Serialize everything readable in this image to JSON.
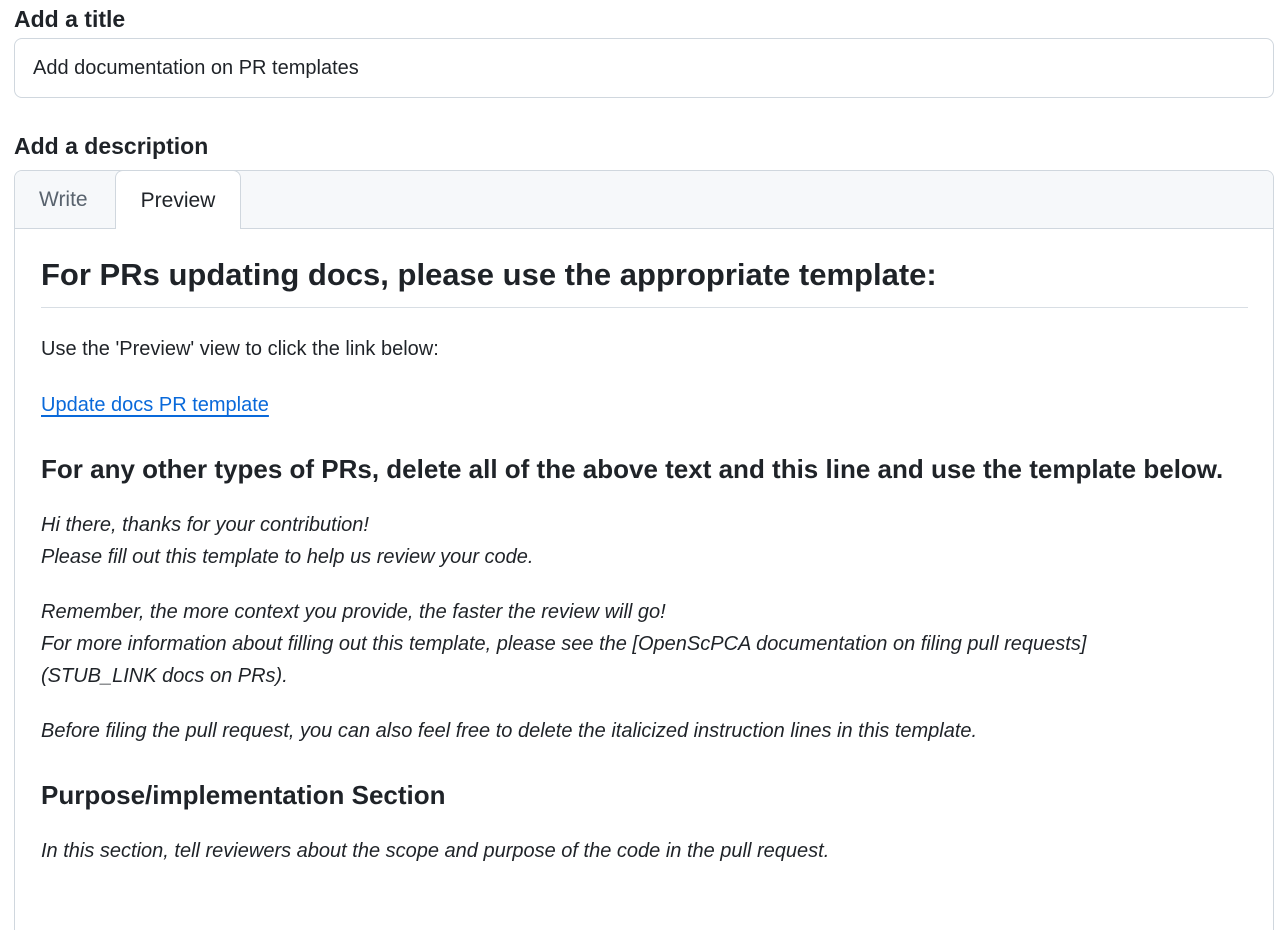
{
  "title_section": {
    "label": "Add a title",
    "value": "Add documentation on PR templates"
  },
  "description_section": {
    "label": "Add a description",
    "tabs": [
      "Write",
      "Preview"
    ],
    "active_tab": "Preview"
  },
  "preview": {
    "heading1": "For PRs updating docs, please use the appropriate template:",
    "intro": "Use the 'Preview' view to click the link below:",
    "link": "Update docs PR template",
    "heading2": "For any other types of PRs, delete all of the above text and this line and use the template below.",
    "italic_block1": [
      "Hi there, thanks for your contribution!",
      "Please fill out this template to help us review your code."
    ],
    "italic_block2": [
      "Remember, the more context you provide, the faster the review will go!",
      "For more information about filling out this template, please see the [OpenScPCA documentation on filing pull requests]",
      "(STUB_LINK docs on PRs)."
    ],
    "italic_block3": "Before filing the pull request, you can also feel free to delete the italicized instruction lines in this template.",
    "heading3": "Purpose/implementation Section",
    "italic_block4": "In this section, tell reviewers about the scope and purpose of the code in the pull request."
  },
  "colors": {
    "link": "#0969da",
    "border": "#d0d7de",
    "tabbar_bg": "#f6f8fa",
    "text": "#1f2328",
    "muted": "#59636e"
  }
}
